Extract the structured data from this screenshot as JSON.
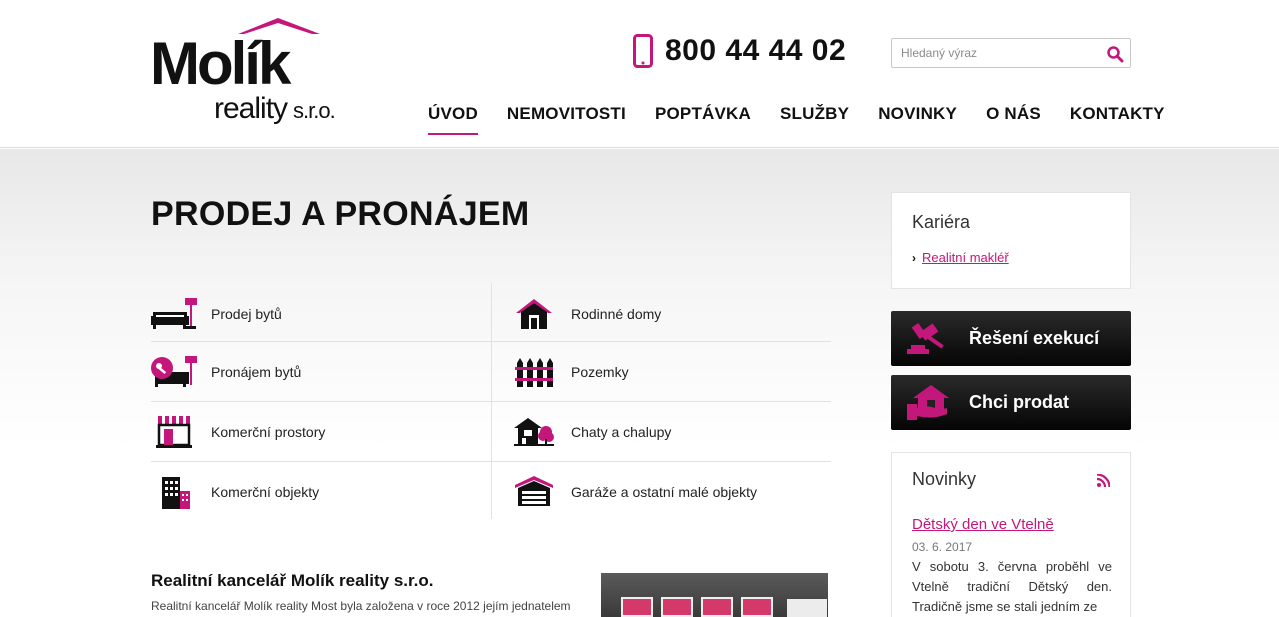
{
  "logo": {
    "main": "Molík",
    "sub": "reality",
    "suffix": "s.r.o."
  },
  "header": {
    "phone": "800 44 44 02",
    "search_placeholder": "Hledaný výraz"
  },
  "nav": [
    {
      "label": "ÚVOD",
      "active": true
    },
    {
      "label": "NEMOVITOSTI"
    },
    {
      "label": "POPTÁVKA"
    },
    {
      "label": "SLUŽBY"
    },
    {
      "label": "NOVINKY"
    },
    {
      "label": "O NÁS"
    },
    {
      "label": "KONTAKTY"
    }
  ],
  "main": {
    "title": "PRODEJ A PRONÁJEM",
    "categories": [
      {
        "label": "Prodej bytů",
        "icon": "sofa-lamp-icon"
      },
      {
        "label": "Rodinné domy",
        "icon": "house-icon"
      },
      {
        "label": "Pronájem bytů",
        "icon": "key-sofa-icon"
      },
      {
        "label": "Pozemky",
        "icon": "fence-icon"
      },
      {
        "label": "Komerční prostory",
        "icon": "shop-awning-icon"
      },
      {
        "label": "Chaty a chalupy",
        "icon": "cottage-tree-icon"
      },
      {
        "label": "Komerční objekty",
        "icon": "office-building-icon"
      },
      {
        "label": "Garáže a ostatní malé objekty",
        "icon": "garage-icon"
      }
    ],
    "about": {
      "title": "Realitní kancelář Molík reality s.r.o.",
      "text": "Realitní kancelář Molík reality Most byla založena v roce 2012 jejím jednatelem"
    }
  },
  "sidebar": {
    "career": {
      "title": "Kariéra",
      "link": "Realitní makléř"
    },
    "buttons": [
      {
        "label": "Řešení exekucí",
        "icon": "gavel-icon"
      },
      {
        "label": "Chci prodat",
        "icon": "house-hand-icon"
      }
    ],
    "news": {
      "title": "Novinky",
      "item_title": "Dětský den ve Vtelně",
      "item_date": "03. 6. 2017",
      "item_text": "V sobotu 3. června  proběhl ve Vtelně tradiční Dětský den. Tradičně jsme se stali jedním ze"
    }
  },
  "colors": {
    "accent": "#c4177b",
    "dark": "#111111"
  }
}
